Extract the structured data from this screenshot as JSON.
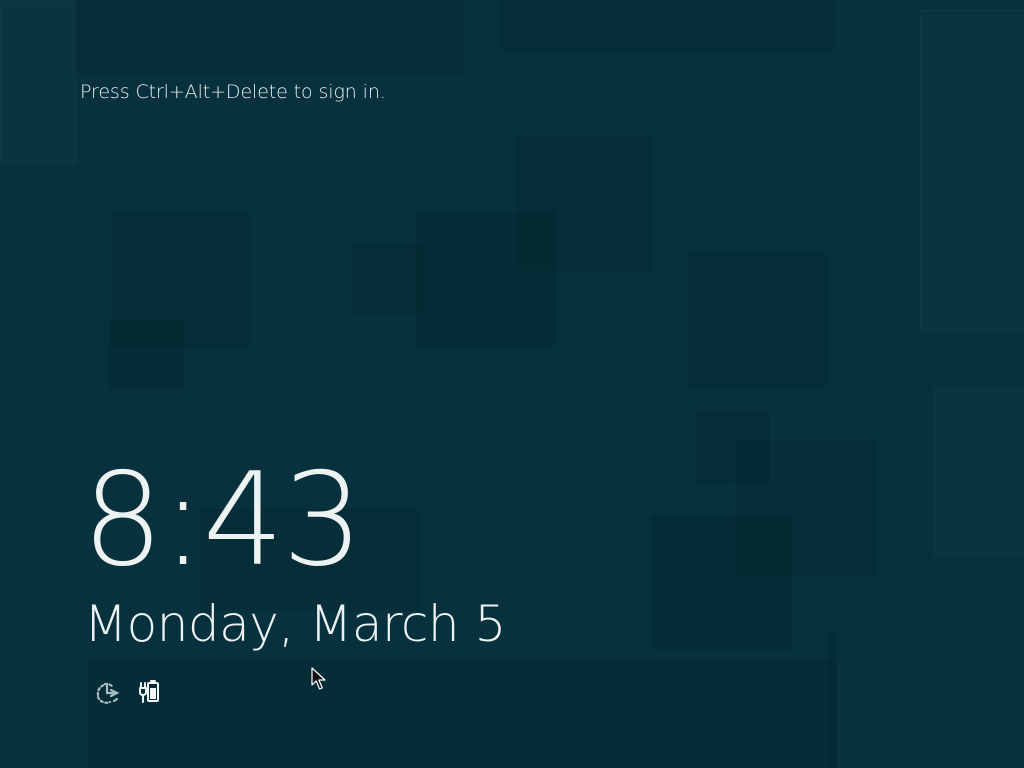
{
  "lock_screen": {
    "prompt": "Press Ctrl+Alt+Delete to sign in.",
    "time": "8:43",
    "date": "Monday, March 5"
  },
  "status_icons": [
    {
      "name": "network-status-icon",
      "semantic_icon": "network-disconnected-icon"
    },
    {
      "name": "battery-status-icon",
      "semantic_icon": "battery-plugged-in-icon"
    }
  ],
  "theme": {
    "background": "#06313d",
    "text": "#edf2f3"
  }
}
